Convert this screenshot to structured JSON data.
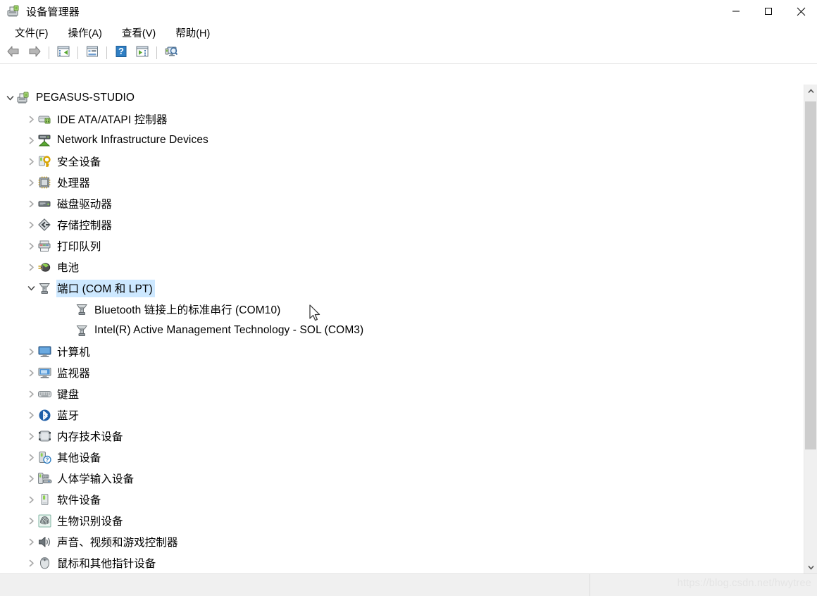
{
  "window": {
    "title": "设备管理器",
    "title_icon": "device-manager-icon",
    "minimize_label": "─",
    "maximize_label": "□",
    "close_label": "✕"
  },
  "menubar": {
    "items": [
      {
        "label": "文件(F)",
        "name": "menu-file"
      },
      {
        "label": "操作(A)",
        "name": "menu-action"
      },
      {
        "label": "查看(V)",
        "name": "menu-view"
      },
      {
        "label": "帮助(H)",
        "name": "menu-help"
      }
    ]
  },
  "toolbar": {
    "buttons": [
      {
        "icon": "back-arrow-icon",
        "title": "后退"
      },
      {
        "icon": "forward-arrow-icon",
        "title": "前进"
      },
      {
        "icon": "show-hide-console-tree-icon",
        "title": "显示/隐藏控制台树"
      },
      {
        "icon": "properties-icon",
        "title": "属性"
      },
      {
        "icon": "help-icon",
        "title": "帮助"
      },
      {
        "icon": "scan-hardware-changes-icon",
        "title": "扫描检测硬件改动"
      },
      {
        "icon": "update-driver-icon",
        "title": "更新驱动程序"
      }
    ]
  },
  "tree": {
    "nodes": [
      {
        "label": "PEGASUS-STUDIO",
        "level": 0,
        "state": "expanded",
        "icon": "computer-root-icon",
        "selected": false
      },
      {
        "label": "IDE ATA/ATAPI 控制器",
        "level": 1,
        "state": "collapsed",
        "icon": "ide-controller-icon",
        "selected": false
      },
      {
        "label": "Network Infrastructure Devices",
        "level": 1,
        "state": "collapsed",
        "icon": "network-infrastructure-icon",
        "selected": false
      },
      {
        "label": "安全设备",
        "level": 1,
        "state": "collapsed",
        "icon": "security-key-icon",
        "selected": false
      },
      {
        "label": "处理器",
        "level": 1,
        "state": "collapsed",
        "icon": "processor-chip-icon",
        "selected": false
      },
      {
        "label": "磁盘驱动器",
        "level": 1,
        "state": "collapsed",
        "icon": "disk-drive-icon",
        "selected": false
      },
      {
        "label": "存储控制器",
        "level": 1,
        "state": "collapsed",
        "icon": "storage-controller-icon",
        "selected": false
      },
      {
        "label": "打印队列",
        "level": 1,
        "state": "collapsed",
        "icon": "print-queue-icon",
        "selected": false
      },
      {
        "label": "电池",
        "level": 1,
        "state": "collapsed",
        "icon": "battery-icon",
        "selected": false
      },
      {
        "label": "端口 (COM 和 LPT)",
        "level": 1,
        "state": "expanded",
        "icon": "port-icon",
        "selected": true
      },
      {
        "label": "Bluetooth 链接上的标准串行 (COM10)",
        "level": 2,
        "state": "leaf",
        "icon": "port-icon",
        "selected": false
      },
      {
        "label": "Intel(R) Active Management Technology - SOL (COM3)",
        "level": 2,
        "state": "leaf",
        "icon": "port-icon",
        "selected": false
      },
      {
        "label": "计算机",
        "level": 1,
        "state": "collapsed",
        "icon": "computer-icon",
        "selected": false
      },
      {
        "label": "监视器",
        "level": 1,
        "state": "collapsed",
        "icon": "monitor-icon",
        "selected": false
      },
      {
        "label": "键盘",
        "level": 1,
        "state": "collapsed",
        "icon": "keyboard-icon",
        "selected": false
      },
      {
        "label": "蓝牙",
        "level": 1,
        "state": "collapsed",
        "icon": "bluetooth-icon",
        "selected": false
      },
      {
        "label": "内存技术设备",
        "level": 1,
        "state": "collapsed",
        "icon": "memory-technology-icon",
        "selected": false
      },
      {
        "label": "其他设备",
        "level": 1,
        "state": "collapsed",
        "icon": "other-devices-icon",
        "selected": false
      },
      {
        "label": "人体学输入设备",
        "level": 1,
        "state": "collapsed",
        "icon": "hid-input-icon",
        "selected": false
      },
      {
        "label": "软件设备",
        "level": 1,
        "state": "collapsed",
        "icon": "software-device-icon",
        "selected": false
      },
      {
        "label": "生物识别设备",
        "level": 1,
        "state": "collapsed",
        "icon": "biometric-icon",
        "selected": false
      },
      {
        "label": "声音、视频和游戏控制器",
        "level": 1,
        "state": "collapsed",
        "icon": "sound-video-game-icon",
        "selected": false
      },
      {
        "label": "鼠标和其他指针设备",
        "level": 1,
        "state": "collapsed",
        "icon": "mouse-icon",
        "selected": false
      }
    ]
  },
  "scrollbar": {
    "up_arrow": "chevron-up-icon",
    "down_arrow": "chevron-down-icon"
  },
  "statusbar": {
    "text": "",
    "watermark": "https://blog.csdn.net/hwytree"
  },
  "colors": {
    "selection": "#cde8ff",
    "window_bg": "#ffffff",
    "status_bg": "#f0f0f0",
    "scrollbar_thumb": "#cdcdcd"
  }
}
